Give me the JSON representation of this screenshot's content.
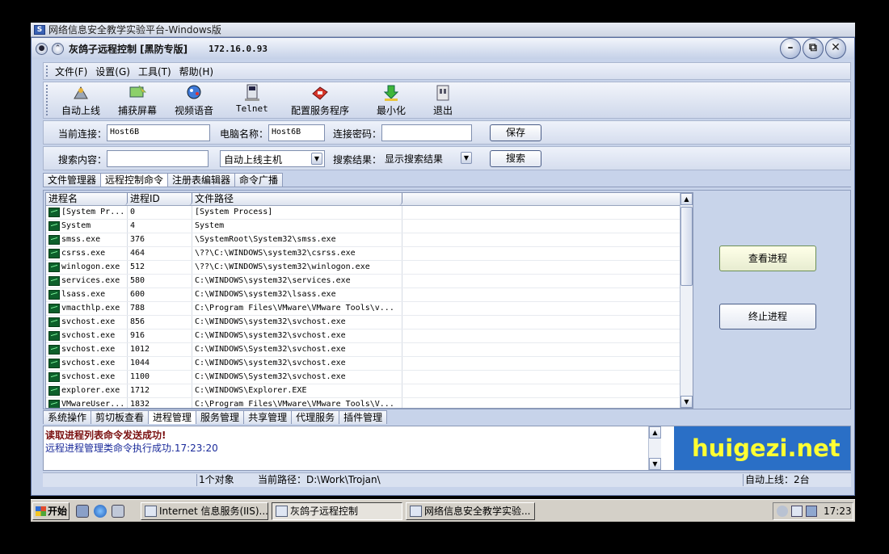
{
  "vm_window": {
    "title": "网络信息安全教学实验平台-Windows版"
  },
  "app": {
    "title": "灰鸽子远程控制  [黑防专版]",
    "ip": "172.16.0.93"
  },
  "menu": [
    {
      "label": "文件(F)"
    },
    {
      "label": "设置(G)"
    },
    {
      "label": "工具(T)"
    },
    {
      "label": "帮助(H)"
    }
  ],
  "toolbar": [
    {
      "label": "自动上线",
      "icon": "auto-online-icon"
    },
    {
      "label": "捕获屏幕",
      "icon": "capture-screen-icon"
    },
    {
      "label": "视频语音",
      "icon": "video-voice-icon"
    },
    {
      "label": "Telnet",
      "icon": "telnet-icon"
    },
    {
      "label": "配置服务程序",
      "icon": "config-service-icon"
    },
    {
      "label": "最小化",
      "icon": "minimize-icon"
    },
    {
      "label": "退出",
      "icon": "exit-icon"
    }
  ],
  "connection": {
    "current_label": "当前连接：",
    "current_value": "Host6B",
    "computer_label": "电脑名称：",
    "computer_value": "Host6B",
    "password_label": "连接密码：",
    "password_value": "",
    "save_button": "保存"
  },
  "search": {
    "content_label": "搜索内容：",
    "content_value": "",
    "host_select": "自动上线主机",
    "result_label": "搜索结果：",
    "result_select": "显示搜索结果",
    "search_button": "搜索"
  },
  "top_tabs": [
    "文件管理器",
    "远程控制命令",
    "注册表编辑器",
    "命令广播"
  ],
  "top_tab_active": 1,
  "process_list": {
    "columns": [
      "进程名",
      "进程ID",
      "文件路径",
      ""
    ],
    "rows": [
      {
        "name": "[System Pr...",
        "pid": "0",
        "path": "[System Process]"
      },
      {
        "name": "System",
        "pid": "4",
        "path": "System"
      },
      {
        "name": "smss.exe",
        "pid": "376",
        "path": "\\SystemRoot\\System32\\smss.exe"
      },
      {
        "name": "csrss.exe",
        "pid": "464",
        "path": "\\??\\C:\\WINDOWS\\system32\\csrss.exe"
      },
      {
        "name": "winlogon.exe",
        "pid": "512",
        "path": "\\??\\C:\\WINDOWS\\system32\\winlogon.exe"
      },
      {
        "name": "services.exe",
        "pid": "580",
        "path": "C:\\WINDOWS\\system32\\services.exe"
      },
      {
        "name": "lsass.exe",
        "pid": "600",
        "path": "C:\\WINDOWS\\system32\\lsass.exe"
      },
      {
        "name": "vmacthlp.exe",
        "pid": "788",
        "path": "C:\\Program Files\\VMware\\VMware Tools\\v..."
      },
      {
        "name": "svchost.exe",
        "pid": "856",
        "path": "C:\\WINDOWS\\system32\\svchost.exe"
      },
      {
        "name": "svchost.exe",
        "pid": "916",
        "path": "C:\\WINDOWS\\system32\\svchost.exe"
      },
      {
        "name": "svchost.exe",
        "pid": "1012",
        "path": "C:\\WINDOWS\\System32\\svchost.exe"
      },
      {
        "name": "svchost.exe",
        "pid": "1044",
        "path": "C:\\WINDOWS\\system32\\svchost.exe"
      },
      {
        "name": "svchost.exe",
        "pid": "1100",
        "path": "C:\\WINDOWS\\System32\\svchost.exe"
      },
      {
        "name": "explorer.exe",
        "pid": "1712",
        "path": "C:\\WINDOWS\\Explorer.EXE"
      },
      {
        "name": "VMwareUser...",
        "pid": "1832",
        "path": "C:\\Program Files\\VMware\\VMware Tools\\V..."
      }
    ]
  },
  "actions": {
    "view_process": "查看进程",
    "kill_process": "终止进程"
  },
  "bottom_tabs": [
    "系统操作",
    "剪切板查看",
    "进程管理",
    "服务管理",
    "共享管理",
    "代理服务",
    "插件管理"
  ],
  "bottom_tab_active": 2,
  "log": {
    "line1": "读取进程列表命令发送成功!",
    "line2": "远程进程管理类命令执行成功.17:23:20"
  },
  "banner": {
    "text": "huigezi.net",
    "bg": "#2a6fc6",
    "fg": "#ffff33"
  },
  "status": {
    "objects": "1个对象",
    "path": "当前路径：D:\\Work\\Trojan\\",
    "online": "自动上线：2台"
  },
  "taskbar": {
    "start": "开始",
    "tasks": [
      "Internet 信息服务(IIS)...",
      "灰鸽子远程控制",
      "网络信息安全教学实验..."
    ],
    "active_task": 1,
    "clock": "17:23"
  }
}
